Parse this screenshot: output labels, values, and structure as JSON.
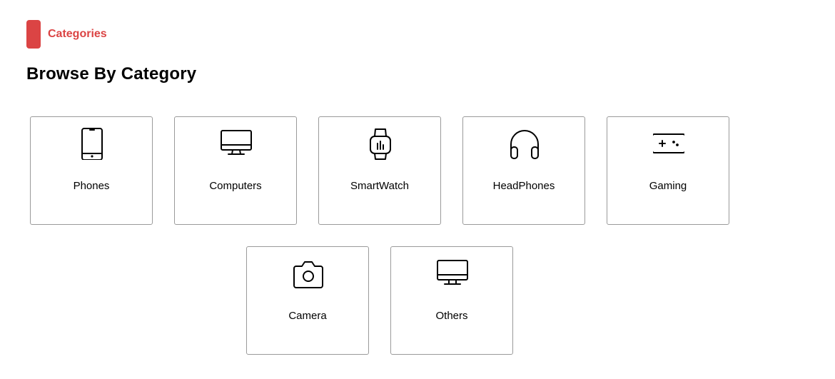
{
  "section": {
    "tag_label": "Categories",
    "heading": "Browse By Category",
    "accent_color": "#DB4444"
  },
  "categories": [
    {
      "label": "Phones",
      "icon": "phone-icon"
    },
    {
      "label": "Computers",
      "icon": "computer-icon"
    },
    {
      "label": "SmartWatch",
      "icon": "smartwatch-icon"
    },
    {
      "label": "HeadPhones",
      "icon": "headphones-icon"
    },
    {
      "label": "Gaming",
      "icon": "gamepad-icon"
    },
    {
      "label": "Camera",
      "icon": "camera-icon"
    },
    {
      "label": "Others",
      "icon": "monitor-icon"
    }
  ]
}
